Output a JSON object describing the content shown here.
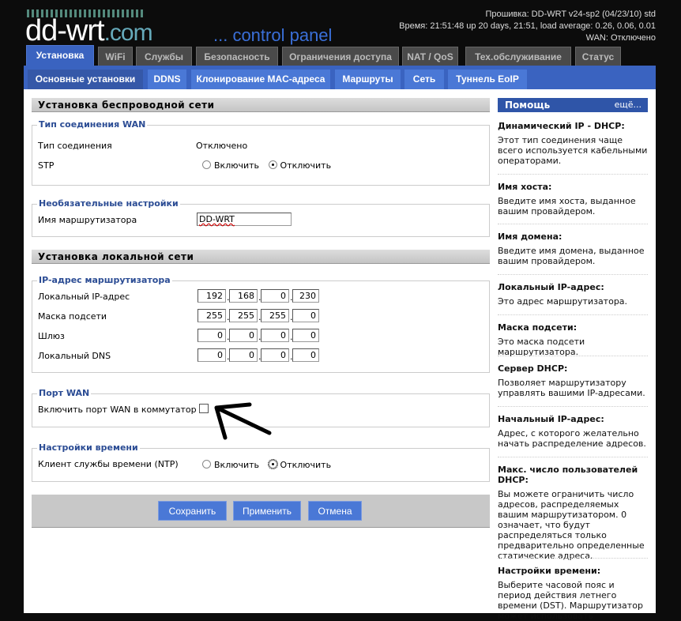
{
  "header": {
    "logo": "dd-wrt",
    "logo_suffix": ".com",
    "subtitle": "... control panel",
    "firmware": "Прошивка: DD-WRT v24-sp2 (04/23/10) std",
    "time": "Время: 21:51:48 up 20 days, 21:51, load average: 0.26, 0.06, 0.01",
    "wan": "WAN: Отключено"
  },
  "tabs": [
    "Установка",
    "WiFi",
    "Службы",
    "Безопасность",
    "Ограничения доступа",
    "NAT / QoS",
    "Тех.обслуживание",
    "Статус"
  ],
  "subtabs": [
    "Основные установки",
    "DDNS",
    "Клонирование MAC-адреса",
    "Маршруты",
    "Сеть",
    "Туннель EoIP"
  ],
  "wireless": {
    "title": "Установка беспроводной сети",
    "wan_legend": "Тип соединения WAN",
    "conn_type_label": "Тип соединения",
    "conn_type_value": "Отключено",
    "stp_label": "STP",
    "enable": "Включить",
    "disable": "Отключить",
    "stp_value": "disable",
    "optional_legend": "Необязательные настройки",
    "router_name_label": "Имя маршрутизатора",
    "router_name": "DD-WRT"
  },
  "lan": {
    "title": "Установка локальной сети",
    "ip_legend": "IP-адрес маршрутизатора",
    "rows": [
      {
        "label": "Локальный IP-адрес",
        "octets": [
          "192",
          "168",
          "0",
          "230"
        ]
      },
      {
        "label": "Маска подсети",
        "octets": [
          "255",
          "255",
          "255",
          "0"
        ]
      },
      {
        "label": "Шлюз",
        "octets": [
          "0",
          "0",
          "0",
          "0"
        ]
      },
      {
        "label": "Локальный DNS",
        "octets": [
          "0",
          "0",
          "0",
          "0"
        ]
      }
    ],
    "wan_port_legend": "Порт WAN",
    "wan_port_label": "Включить порт WAN в коммутатор",
    "wan_port_checked": false,
    "time_legend": "Настройки времени",
    "ntp_label": "Клиент службы времени (NTP)",
    "ntp_value": "disable"
  },
  "buttons": {
    "save": "Сохранить",
    "apply": "Применить",
    "cancel": "Отмена"
  },
  "help": {
    "title": "Помощь",
    "more": "ещё...",
    "items": [
      {
        "t": "Динамический IP - DHCP:",
        "d": "Этот тип соединения чаще всего используется кабельными операторами."
      },
      {
        "t": "Имя хоста:",
        "d": "Введите имя хоста, выданное вашим провайдером."
      },
      {
        "t": "Имя домена:",
        "d": "Введите имя домена, выданное вашим провайдером."
      },
      {
        "t": "Локальный IP-адрес:",
        "d": "Это адрес маршрутизатора."
      },
      {
        "t": "Маска подсети:",
        "d": "Это маска подсети маршрутизатора."
      },
      {
        "t": "Сервер DHCP:",
        "d": "Позволяет маршрутизатору управлять вашими IP-адресами."
      },
      {
        "t": "Начальный IP-адрес:",
        "d": "Адрес, с которого желательно начать распределение адресов."
      },
      {
        "t": "Макс. число пользователей DHCP:",
        "d": "Вы можете ограничить число адресов, распределяемых вашим маршрутизатором. 0 означает, что будут распределяться только предварительно определенные статические адреса."
      },
      {
        "t": "Настройки времени:",
        "d": "Выберите часовой пояс и период действия летнего времени (DST). Маршрутизатор может использовать"
      }
    ]
  }
}
